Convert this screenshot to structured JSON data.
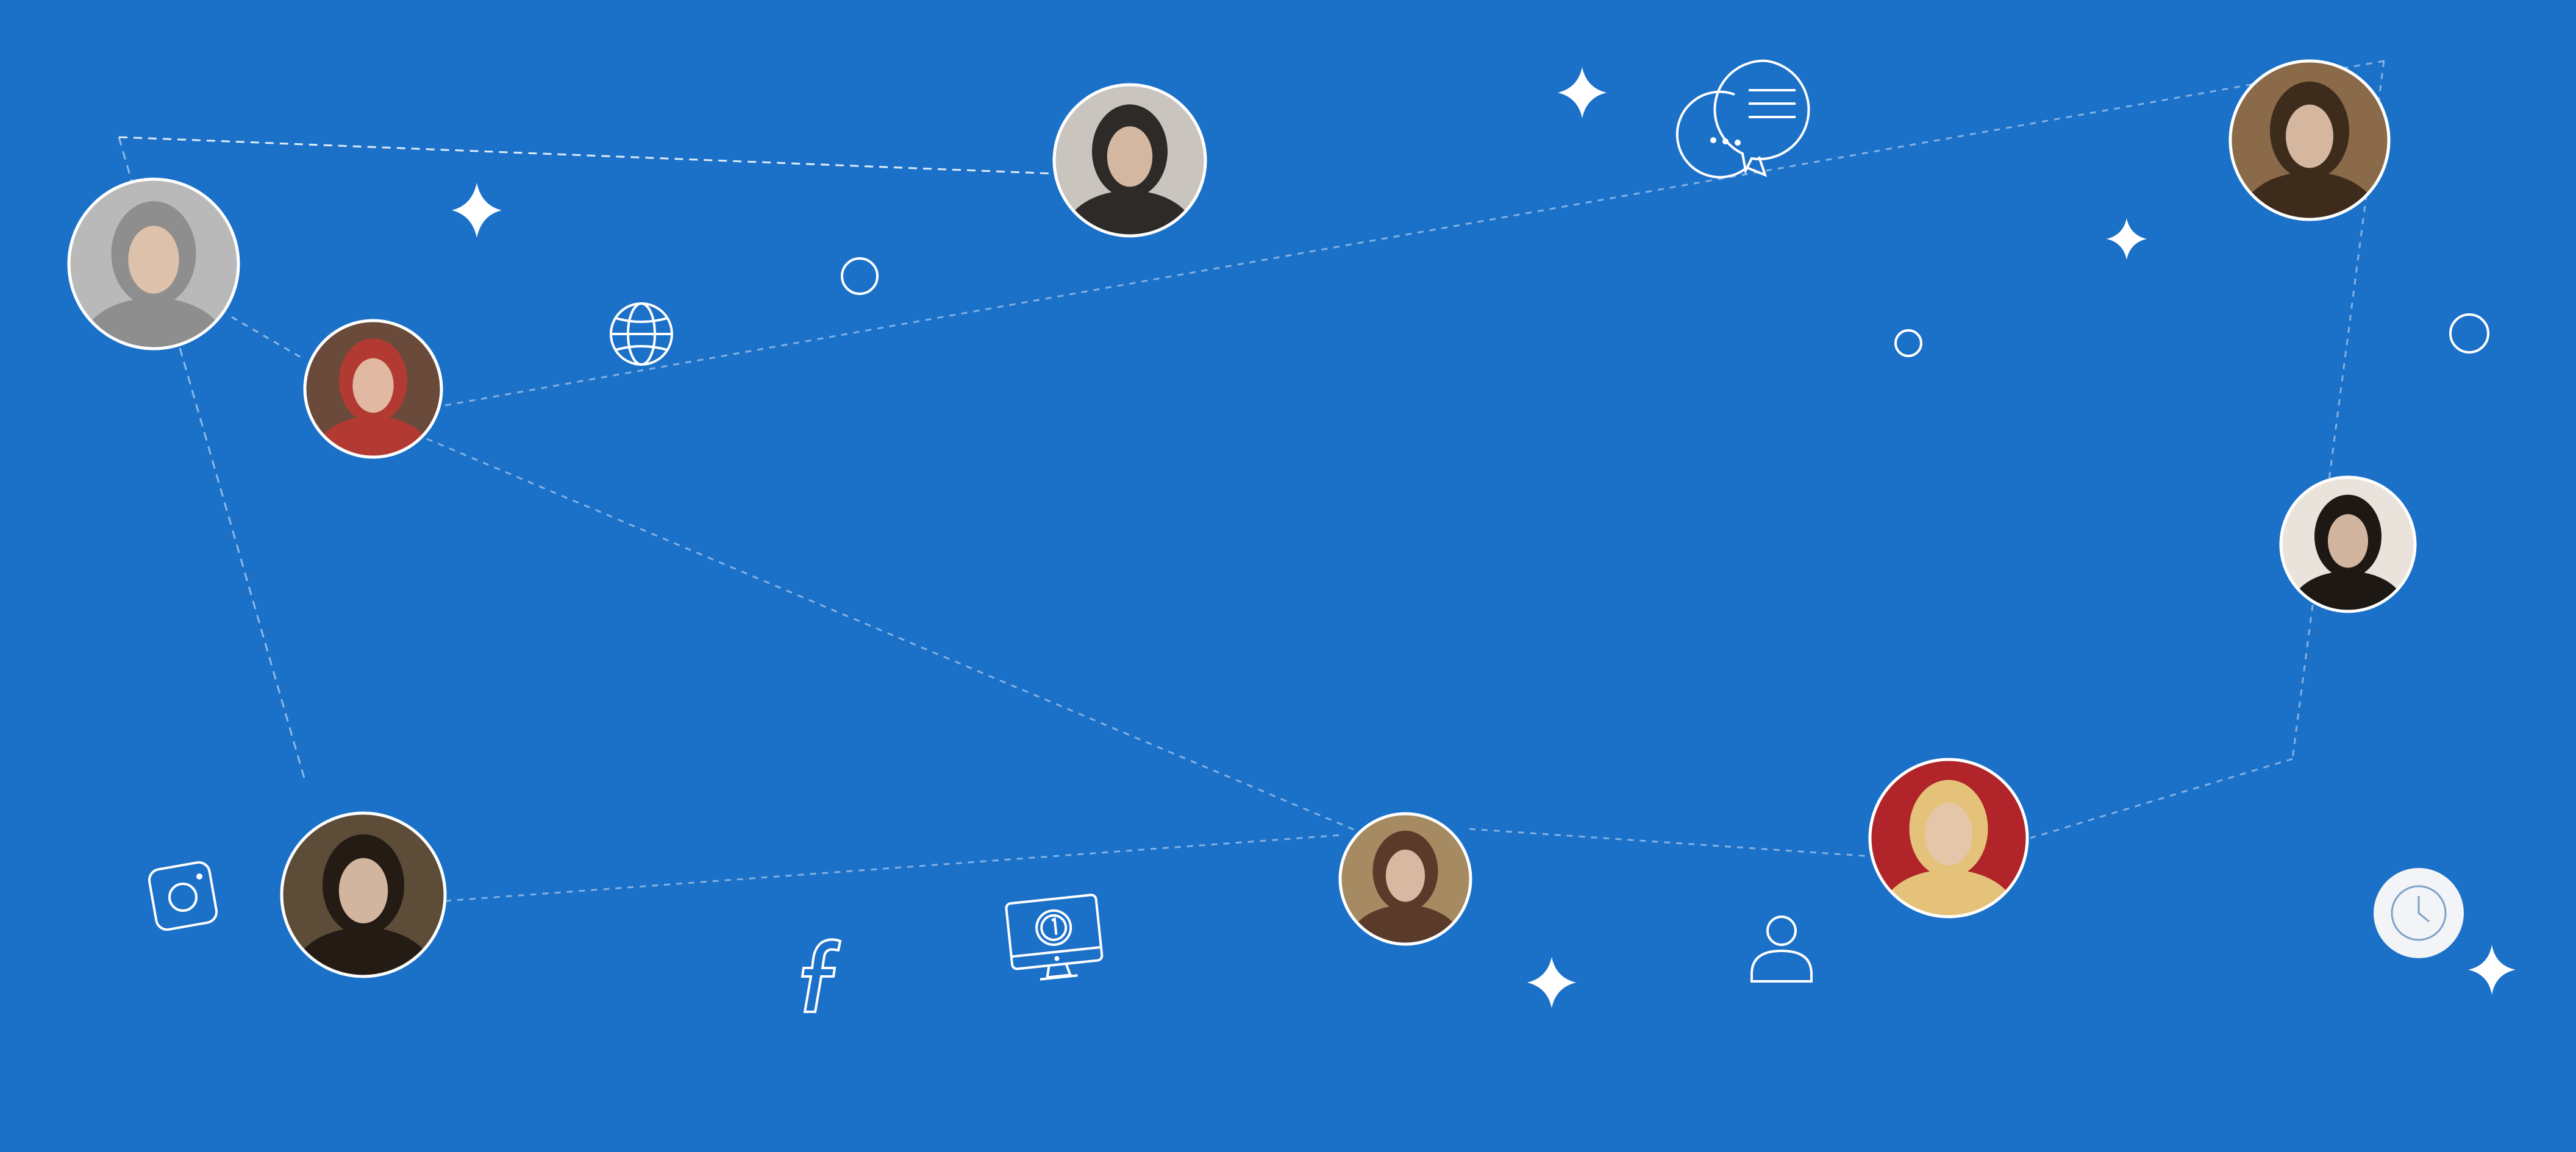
{
  "colors": {
    "background": "#1B70C8",
    "line": "#FFFFFF",
    "badge_fill": "#F2F4F7",
    "badge_icon": "#7EA1C9"
  },
  "avatars": [
    {
      "name": "avatar-woman-grayscale-updo",
      "tone": "#B9B9B9",
      "shade": "#8E8E8E"
    },
    {
      "name": "avatar-man-plaid-shirt",
      "tone": "#6A4A3A",
      "shade": "#B33A32"
    },
    {
      "name": "avatar-woman-blonde-bw",
      "tone": "#C9C4BE",
      "shade": "#2E2A27"
    },
    {
      "name": "avatar-woman-renaissance",
      "tone": "#8A6A48",
      "shade": "#3D2B1C"
    },
    {
      "name": "avatar-woman-dark-hair-plaid",
      "tone": "#E9E3DC",
      "shade": "#1E1814"
    },
    {
      "name": "avatar-woman-dark-hair",
      "tone": "#5C4C38",
      "shade": "#241B14"
    },
    {
      "name": "avatar-girl-long-hair",
      "tone": "#A58A62",
      "shade": "#5A3A28"
    },
    {
      "name": "avatar-woman-blonde-red-bg",
      "tone": "#B0242A",
      "shade": "#E4C27A"
    }
  ],
  "icons": [
    "globe-icon",
    "chat-bubbles-icon",
    "instagram-icon",
    "facebook-icon",
    "desktop-monitor-icon",
    "user-icon",
    "clock-badge-icon",
    "sparkle-icon",
    "small-circle-icon"
  ]
}
